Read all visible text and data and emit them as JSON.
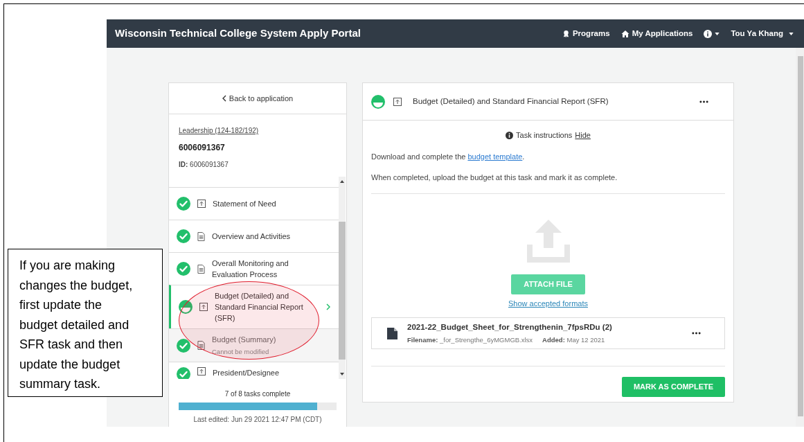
{
  "navbar": {
    "title": "Wisconsin Technical College System Apply Portal",
    "links": [
      {
        "label": "Programs",
        "kind": "award"
      },
      {
        "label": "My Applications",
        "kind": "home"
      }
    ],
    "user": "Tou Ya Khang"
  },
  "sidebar": {
    "back": "Back to application",
    "program": "Leadership (124-182/192)",
    "app_number": "6006091367",
    "id_label": "ID:",
    "id_value": "6006091367",
    "tasks": [
      {
        "title": "Statement of Need",
        "complete": true,
        "kind": "upload",
        "selected": false,
        "disabled": false
      },
      {
        "title": "Overview and Activities",
        "complete": true,
        "kind": "document",
        "selected": false,
        "disabled": false
      },
      {
        "title": "Overall Monitoring and Evaluation Process",
        "complete": true,
        "kind": "document",
        "selected": false,
        "disabled": false
      },
      {
        "title": "Budget (Detailed) and Standard Financial Report (SFR)",
        "complete": false,
        "kind": "upload",
        "selected": true,
        "disabled": false
      },
      {
        "title": "Budget (Summary)",
        "subtitle": "Cannot be modified",
        "complete": true,
        "kind": "document",
        "selected": false,
        "disabled": true
      },
      {
        "title": "President/Designee",
        "complete": true,
        "kind": "upload",
        "selected": false,
        "disabled": false
      }
    ],
    "progress_text": "7 of 8 tasks complete",
    "level": 0.875,
    "last_edited": "Last edited: Jun 29 2021 12:47 PM (CDT)"
  },
  "task": {
    "title": "Budget (Detailed) and Standard Financial Report (SFR)",
    "complete": false,
    "kind": "upload",
    "instructions_label": "Task instructions",
    "hide": "Hide",
    "paragraphs": [
      {
        "before": "Download and complete the ",
        "link": "budget template",
        "after": "."
      },
      {
        "before": "When completed, upload the budget at this task and mark it as complete."
      }
    ],
    "attach": "ATTACH FILE",
    "formats_link": "Show accepted formats",
    "file": {
      "name": "2021-22_Budget_Sheet_for_Strengthenin_7fpsRDu (2)",
      "filename_label": "Filename:",
      "filename": "_for_Strengthe_6yMGMGB.xlsx",
      "added_label": "Added:",
      "added": "May 12 2021"
    },
    "complete_button": "MARK AS COMPLETE"
  },
  "annotation": {
    "note": "If you are making changes the budget, first update the budget detailed and SFR task and then update the budget summary task."
  }
}
